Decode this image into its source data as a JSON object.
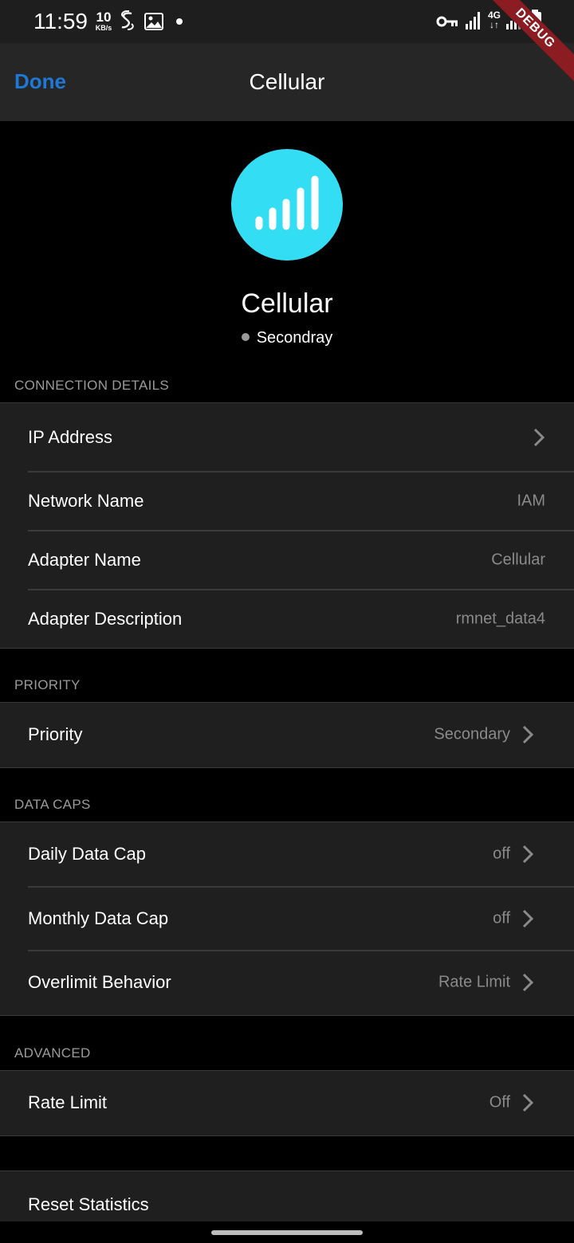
{
  "status_bar": {
    "time": "11:59",
    "speed_value": "10",
    "speed_unit": "KB/s",
    "network_label": "4G",
    "icons": [
      "s-logo-icon",
      "image-icon",
      "notification-dot-icon",
      "vpn-key-icon",
      "signal-icon",
      "network-4g-icon",
      "signal-icon",
      "battery-icon"
    ]
  },
  "debug_banner": "DEBUG",
  "app_bar": {
    "done_label": "Done",
    "title": "Cellular"
  },
  "hero": {
    "icon": "cellular-signal-icon",
    "icon_color": "#33def5",
    "title": "Cellular",
    "status": "Secondray"
  },
  "sections": {
    "connection": {
      "label": "CONNECTION DETAILS",
      "rows": [
        {
          "label": "IP Address",
          "value": ""
        },
        {
          "label": "Network Name",
          "value": "IAM"
        },
        {
          "label": "Adapter Name",
          "value": "Cellular"
        },
        {
          "label": "Adapter Description",
          "value": "rmnet_data4"
        }
      ]
    },
    "priority": {
      "label": "PRIORITY",
      "rows": [
        {
          "label": "Priority",
          "value": "Secondary"
        }
      ]
    },
    "data_caps": {
      "label": "DATA CAPS",
      "rows": [
        {
          "label": "Daily Data Cap",
          "value": "off"
        },
        {
          "label": "Monthly Data Cap",
          "value": "off"
        },
        {
          "label": "Overlimit Behavior",
          "value": "Rate Limit"
        }
      ]
    },
    "advanced": {
      "label": "ADVANCED",
      "rows": [
        {
          "label": "Rate Limit",
          "value": "Off"
        }
      ]
    },
    "reset": {
      "label": "Reset Statistics"
    }
  },
  "colors": {
    "accent": "#1e78d6",
    "background": "#000000",
    "group_bg": "#1f1f1f",
    "app_bar_bg": "#262626",
    "secondary_text": "#8a8a8a"
  }
}
